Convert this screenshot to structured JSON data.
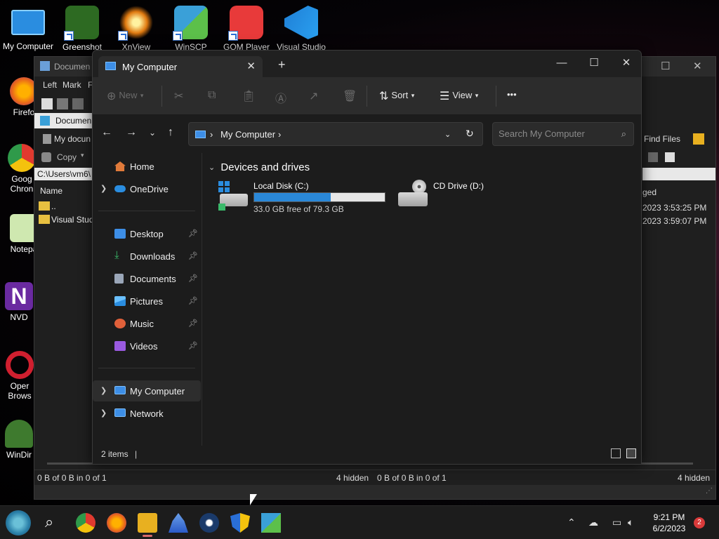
{
  "desktop": {
    "top_icons": [
      {
        "label": "My Computer",
        "color": "#2a8de0"
      },
      {
        "label": "Greenshot",
        "color": "#3a9a2e"
      },
      {
        "label": "XnView",
        "color": "#e07a10"
      },
      {
        "label": "WinSCP",
        "color": "#3aa0d8"
      },
      {
        "label": "GOM Player",
        "color": "#e83a3a"
      },
      {
        "label": "Visual Studio",
        "color": "#1f7fd6"
      }
    ],
    "left_icons": [
      {
        "label": "Firefo",
        "color": "#e8661c"
      },
      {
        "label": "Goog Chron",
        "color": "#2f9a4a"
      },
      {
        "label": "Notepa",
        "color": "#8bbf5a"
      },
      {
        "label": "NVD",
        "color": "#6a2aa0"
      },
      {
        "label": "Oper Brows",
        "color": "#d01f2f"
      },
      {
        "label": "WinDir",
        "color": "#3e7a2e"
      }
    ]
  },
  "bg_window": {
    "title": "Documen",
    "menu": [
      "Left",
      "Mark",
      "F"
    ],
    "left_tab": "Documen",
    "left_path_item": "My docun",
    "copy_label": "Copy",
    "path": "C:\\Users\\vm6\\",
    "col_name": "Name",
    "rows": [
      "..",
      "Visual Stud"
    ],
    "right_find": "Find Files",
    "right_col": "ged",
    "right_dates": [
      "2023 3:53:25 PM",
      "2023 3:59:07 PM"
    ],
    "status_left": "0 B of 0 B in 0 of 1",
    "status_hidden_left": "4 hidden",
    "status_right": "0 B of 0 B in 0 of 1",
    "status_hidden_right": "4 hidden"
  },
  "explorer": {
    "tab_title": "My Computer",
    "toolbar": {
      "new": "New",
      "sort": "Sort",
      "view": "View",
      "more": "•••"
    },
    "address": {
      "location": "My Computer"
    },
    "search_placeholder": "Search My Computer",
    "sidebar": {
      "home": "Home",
      "onedrive": "OneDrive",
      "quick": [
        "Desktop",
        "Downloads",
        "Documents",
        "Pictures",
        "Music",
        "Videos"
      ],
      "this_pc": "My Computer",
      "network": "Network"
    },
    "group_title": "Devices and drives",
    "drives": [
      {
        "name": "Local Disk (C:)",
        "free": "33.0 GB free of 79.3 GB",
        "used_fraction": 0.584
      },
      {
        "name": "CD Drive (D:)"
      }
    ],
    "status": "2 items"
  },
  "taskbar": {
    "time": "9:21 PM",
    "date": "6/2/2023",
    "notifications": "2"
  }
}
